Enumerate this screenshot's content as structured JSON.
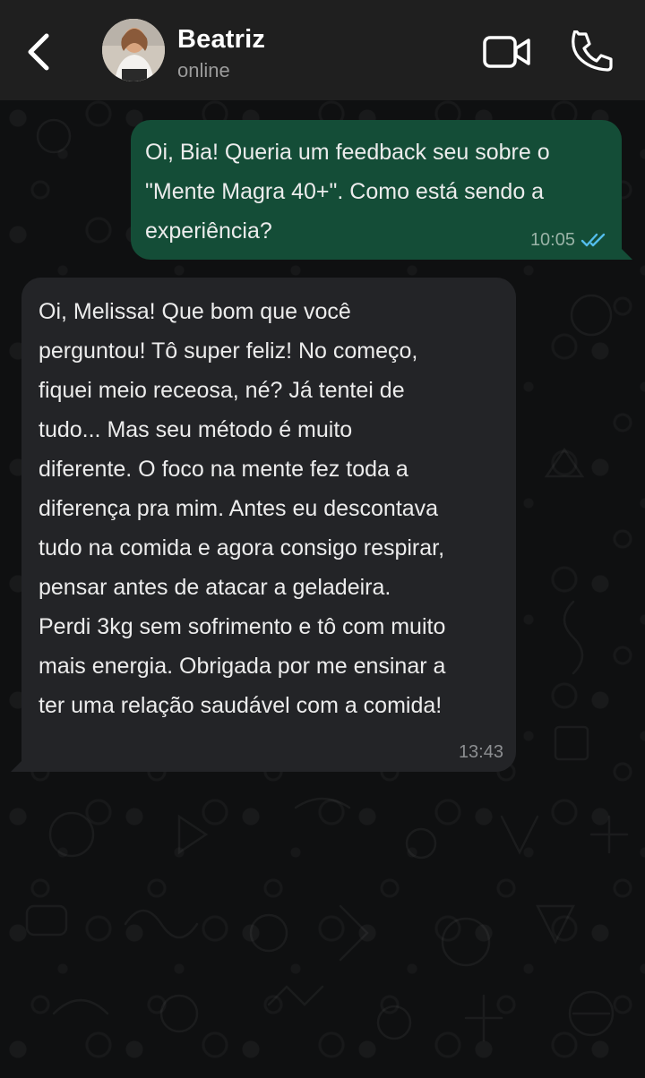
{
  "header": {
    "contact_name": "Beatriz",
    "contact_status": "online",
    "icons": {
      "back": "chevron-left-icon",
      "video": "video-camera-icon",
      "call": "phone-icon"
    }
  },
  "messages": [
    {
      "direction": "outgoing",
      "text": "Oi, Bia! Queria um feedback seu sobre o\n\"Mente Magra 40+\". Como está sendo a\nexperiência?",
      "time": "10:05",
      "read_receipt": "double-check-icon",
      "read_color": "#53bdeb"
    },
    {
      "direction": "incoming",
      "text": "Oi, Melissa! Que bom que você\nperguntou! Tô super feliz! No começo,\nfiquei meio receosa, né? Já tentei de\ntudo... Mas seu método é muito\ndiferente. O foco na mente fez toda a\ndiferença pra mim. Antes eu descontava\ntudo na comida e agora consigo respirar,\npensar antes de atacar a geladeira.\nPerdi 3kg sem sofrimento e tô com muito\nmais energia. Obrigada por me ensinar a\nter uma relação saudável com a comida!",
      "time": "13:43"
    }
  ],
  "colors": {
    "header_bg": "#1f1f1f",
    "outgoing_bubble": "#144d37",
    "incoming_bubble": "#232427",
    "chat_bg": "#0f1011"
  }
}
